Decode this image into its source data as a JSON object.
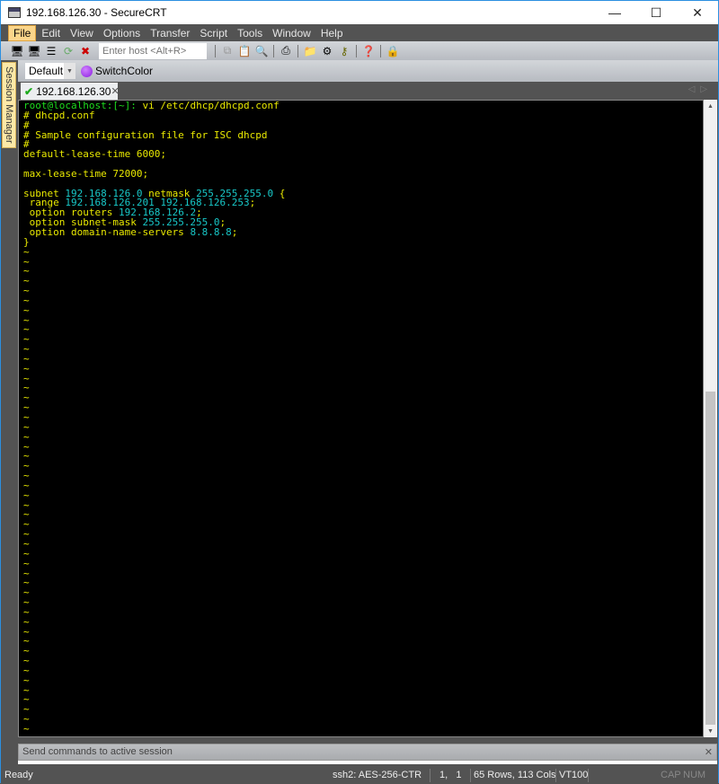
{
  "window": {
    "title": "192.168.126.30 - SecureCRT"
  },
  "menu": [
    "File",
    "Edit",
    "View",
    "Options",
    "Transfer",
    "Script",
    "Tools",
    "Window",
    "Help"
  ],
  "toolbar": {
    "host_placeholder": "Enter host <Alt+R>"
  },
  "toolbar2": {
    "color_scheme": "Default",
    "switch_color": "SwitchColor"
  },
  "session_manager": "Session Manager",
  "tab": {
    "label": "192.168.126.30"
  },
  "terminal": {
    "prompt": "root@localhost:[~]:",
    "command": " vi /etc/dhcp/dhcpd.conf",
    "lines": [
      [
        [
          "y",
          "# dhcpd.conf"
        ]
      ],
      [
        [
          "y",
          "#"
        ]
      ],
      [
        [
          "y",
          "# Sample configuration file for ISC dhcpd"
        ]
      ],
      [
        [
          "y",
          "#"
        ]
      ],
      [
        [
          "y",
          "default-lease-time 6000;"
        ]
      ],
      [
        [
          "y",
          ""
        ]
      ],
      [
        [
          "y",
          "max-lease-time 72000;"
        ]
      ],
      [
        [
          "y",
          ""
        ]
      ],
      [
        [
          "y",
          "subnet "
        ],
        [
          "c",
          "192.168.126.0"
        ],
        [
          "y",
          " netmask "
        ],
        [
          "c",
          "255.255.255.0"
        ],
        [
          "y",
          " {"
        ]
      ],
      [
        [
          "y",
          " range "
        ],
        [
          "c",
          "192.168.126.201 192.168.126.253"
        ],
        [
          "y",
          ";"
        ]
      ],
      [
        [
          "y",
          " option routers "
        ],
        [
          "c",
          "192.168.126.2"
        ],
        [
          "y",
          ";"
        ]
      ],
      [
        [
          "y",
          " option subnet-mask "
        ],
        [
          "c",
          "255.255.255.0"
        ],
        [
          "y",
          ";"
        ]
      ],
      [
        [
          "y",
          " option domain-name-servers "
        ],
        [
          "c",
          "8.8.8.8"
        ],
        [
          "y",
          ";"
        ]
      ],
      [
        [
          "y",
          "}"
        ]
      ]
    ],
    "tilde_count": 50
  },
  "command_bar": {
    "placeholder": "Send commands to active session"
  },
  "status": {
    "ready": "Ready",
    "cipher": "ssh2: AES-256-CTR",
    "cursor": "1,   1",
    "size": "65 Rows, 113 Cols",
    "emulation": "VT100",
    "cap": "CAP",
    "num": "NUM"
  }
}
